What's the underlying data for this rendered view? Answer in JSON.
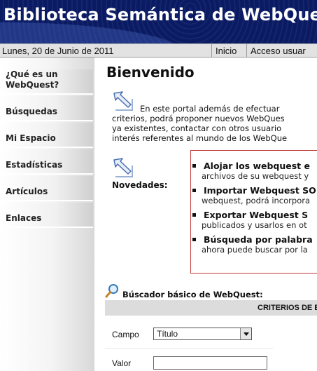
{
  "header": {
    "title": "Biblioteca Semántica de WebQuest :"
  },
  "topbar": {
    "date": "Lunes, 20 de Junio de 2011",
    "nav": [
      {
        "label": "Inicio"
      },
      {
        "label": "Acceso usuar"
      }
    ]
  },
  "sidebar": {
    "items": [
      {
        "label": "¿Qué es un WebQuest?"
      },
      {
        "label": "Búsquedas"
      },
      {
        "label": "Mi Espacio"
      },
      {
        "label": "Estadísticas"
      },
      {
        "label": "Artículos"
      },
      {
        "label": "Enlaces"
      }
    ]
  },
  "main": {
    "heading": "Bienvenido",
    "intro_lines": [
      "En este portal además de efectuar",
      "criterios, podrá proponer nuevos WebQues",
      "ya existentes, contactar con otros usuario",
      "interés referentes al mundo de los WebQue"
    ],
    "novedades_label": "Novedades:",
    "news": [
      {
        "title": "Alojar los webquest e",
        "desc": "archivos de su webquest y"
      },
      {
        "title": "Importar Webquest SO",
        "desc": "webquest, podrá incorpora"
      },
      {
        "title": "Exportar Webquest S",
        "desc": "publicados y usarlos en ot"
      },
      {
        "title": "Búsqueda por palabra",
        "desc": "ahora puede buscar por la"
      }
    ],
    "search": {
      "title": "Búscador básico de WebQuest:",
      "criteria_header": "CRITERIOS DE B",
      "campo_label": "Campo",
      "campo_value": "Título",
      "valor_label": "Valor",
      "valor_value": ""
    }
  },
  "icons": {
    "arrow": "arrow-icon",
    "magnifier": "magnifier-icon",
    "dropdown": "chevron-down-icon"
  },
  "colors": {
    "banner": "#0a1a63",
    "news_border": "#c23a3a",
    "topbar": "#e2e2e2"
  }
}
